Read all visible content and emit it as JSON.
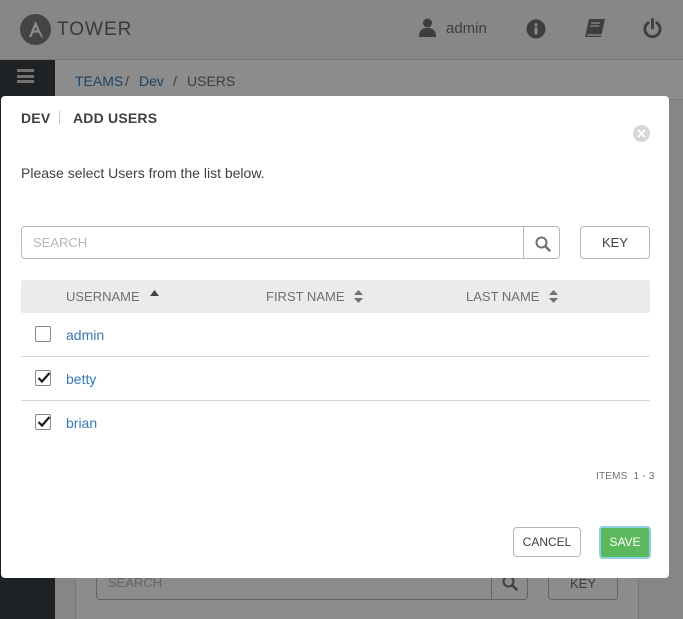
{
  "app": {
    "brand": "TOWER",
    "user_name": "admin"
  },
  "breadcrumb": {
    "items": [
      {
        "label": "TEAMS"
      },
      {
        "label": "Dev"
      },
      {
        "label": "USERS"
      }
    ],
    "separator": "/"
  },
  "background": {
    "search_placeholder": "SEARCH",
    "key_label": "KEY"
  },
  "modal": {
    "title": "DEV",
    "subtitle": "ADD USERS",
    "instructions": "Please select Users from the list below.",
    "search": {
      "placeholder": "SEARCH",
      "value": ""
    },
    "key_label": "KEY",
    "columns": [
      {
        "label": "USERNAME",
        "sort": "asc"
      },
      {
        "label": "FIRST NAME",
        "sort": "both"
      },
      {
        "label": "LAST NAME",
        "sort": "both"
      }
    ],
    "rows": [
      {
        "username": "admin",
        "first_name": "",
        "last_name": "",
        "checked": false
      },
      {
        "username": "betty",
        "first_name": "",
        "last_name": "",
        "checked": true
      },
      {
        "username": "brian",
        "first_name": "",
        "last_name": "",
        "checked": true
      }
    ],
    "items_label": "ITEMS",
    "items_range": "1 - 3",
    "cancel_label": "CANCEL",
    "save_label": "SAVE"
  },
  "colors": {
    "link": "#337ab7",
    "save": "#5cb85c",
    "sidenav": "#393f44"
  },
  "icons": [
    "ansible-logo-icon",
    "user-icon",
    "info-icon",
    "book-icon",
    "power-icon",
    "hamburger-icon",
    "close-icon",
    "search-icon",
    "sort-icon",
    "checkmark-icon"
  ]
}
